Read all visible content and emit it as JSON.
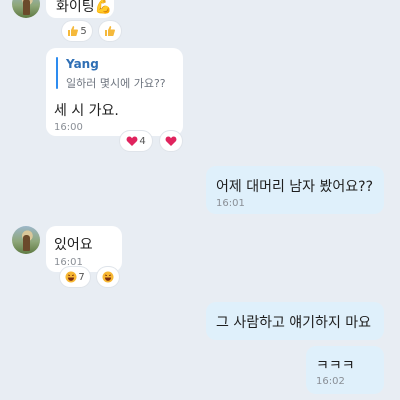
{
  "messages": [
    {
      "text": "화이팅💪",
      "reactions": [
        {
          "icon": "thumbs-up-icon",
          "count": "5"
        },
        {
          "icon": "thumbs-up-icon",
          "count": ""
        }
      ]
    },
    {
      "quote": {
        "name": "Yang",
        "text": "일하러 몇시에 가요??"
      },
      "text": "세 시 가요.",
      "time": "16:00",
      "reactions": [
        {
          "icon": "heart-icon",
          "count": "4"
        },
        {
          "icon": "heart-icon",
          "count": ""
        }
      ]
    },
    {
      "text": "어제 대머리 남자 봤어요??",
      "time": "16:01"
    },
    {
      "text": "있어요",
      "time": "16:01",
      "reactions": [
        {
          "icon": "laughing-face-icon",
          "count": "7"
        },
        {
          "icon": "laughing-face-icon",
          "count": ""
        }
      ]
    },
    {
      "text": "그 사람하고 얘기하지 마요"
    },
    {
      "text": "ㅋㅋㅋ",
      "time": "16:02"
    }
  ],
  "colors": {
    "background": "#e8edf3",
    "incoming": "#ffffff",
    "outgoing": "#dff0fb",
    "quote_accent": "#2d8cf0",
    "heart": "#e0245e"
  }
}
